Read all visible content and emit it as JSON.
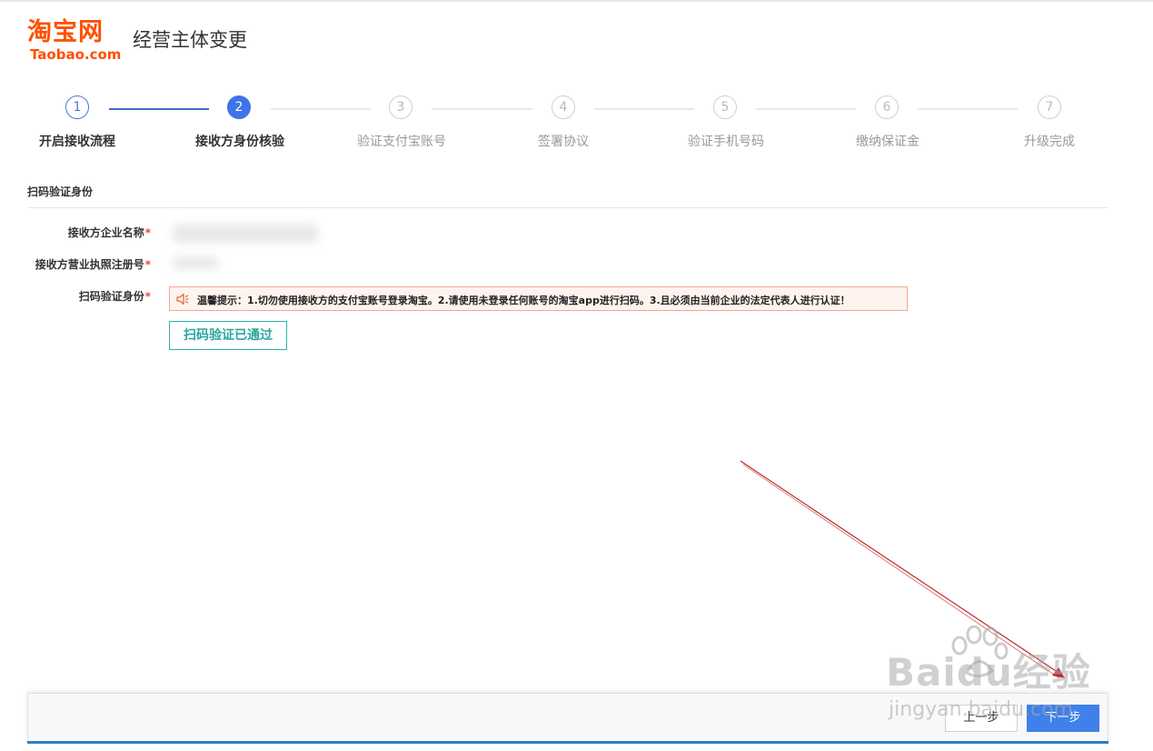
{
  "header": {
    "logo_cn": "淘宝网",
    "logo_en": "Taobao.com",
    "title": "经营主体变更"
  },
  "steps": [
    {
      "num": "1",
      "label": "开启接收流程",
      "state": "done"
    },
    {
      "num": "2",
      "label": "接收方身份核验",
      "state": "active"
    },
    {
      "num": "3",
      "label": "验证支付宝账号",
      "state": "pending"
    },
    {
      "num": "4",
      "label": "签署协议",
      "state": "pending"
    },
    {
      "num": "5",
      "label": "验证手机号码",
      "state": "pending"
    },
    {
      "num": "6",
      "label": "缴纳保证金",
      "state": "pending"
    },
    {
      "num": "7",
      "label": "升级完成",
      "state": "pending"
    }
  ],
  "section": {
    "title": "扫码验证身份"
  },
  "form": {
    "company_name_label": "接收方企业名称",
    "license_no_label": "接收方营业执照注册号",
    "scan_label": "扫码验证身份",
    "required_mark": "*"
  },
  "warning": {
    "text": "温馨提示：1.切勿使用接收方的支付宝账号登录淘宝。2.请使用未登录任何账号的淘宝app进行扫码。3.且必须由当前企业的法定代表人进行认证！",
    "icon": "speaker-icon"
  },
  "scan_button": {
    "label": "扫码验证已通过"
  },
  "footer": {
    "prev_label": "上一步",
    "next_label": "下一步"
  },
  "watermark": {
    "main": "Baidu经验",
    "sub": "jingyan.baidu.com"
  },
  "colors": {
    "brand": "#ff5000",
    "active_step": "#3f73e8",
    "teal": "#2aa69d",
    "primary": "#3f80ea",
    "annotation_arrow": "#c0282d"
  }
}
